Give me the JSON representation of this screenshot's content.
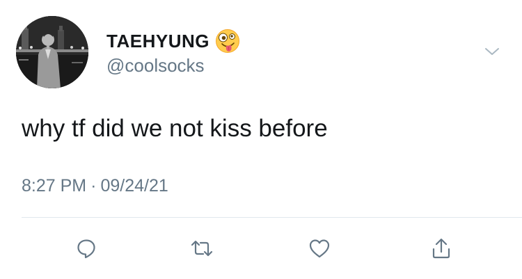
{
  "tweet": {
    "author": {
      "display_name": "TAEHYUNG",
      "handle": "@coolsocks",
      "name_emoji": "zany-face-emoji"
    },
    "text": "why tf did we not kiss before",
    "time": "8:27 PM",
    "separator": "·",
    "date": "09/24/21"
  },
  "actions": [
    {
      "name": "reply",
      "icon": "reply-bubble-icon"
    },
    {
      "name": "retweet",
      "icon": "retweet-icon"
    },
    {
      "name": "like",
      "icon": "heart-icon"
    },
    {
      "name": "share",
      "icon": "share-icon"
    }
  ],
  "colors": {
    "text_primary": "#14171a",
    "text_secondary": "#657786",
    "icon": "#657786",
    "divider": "#e1e8ed",
    "background": "#ffffff"
  }
}
